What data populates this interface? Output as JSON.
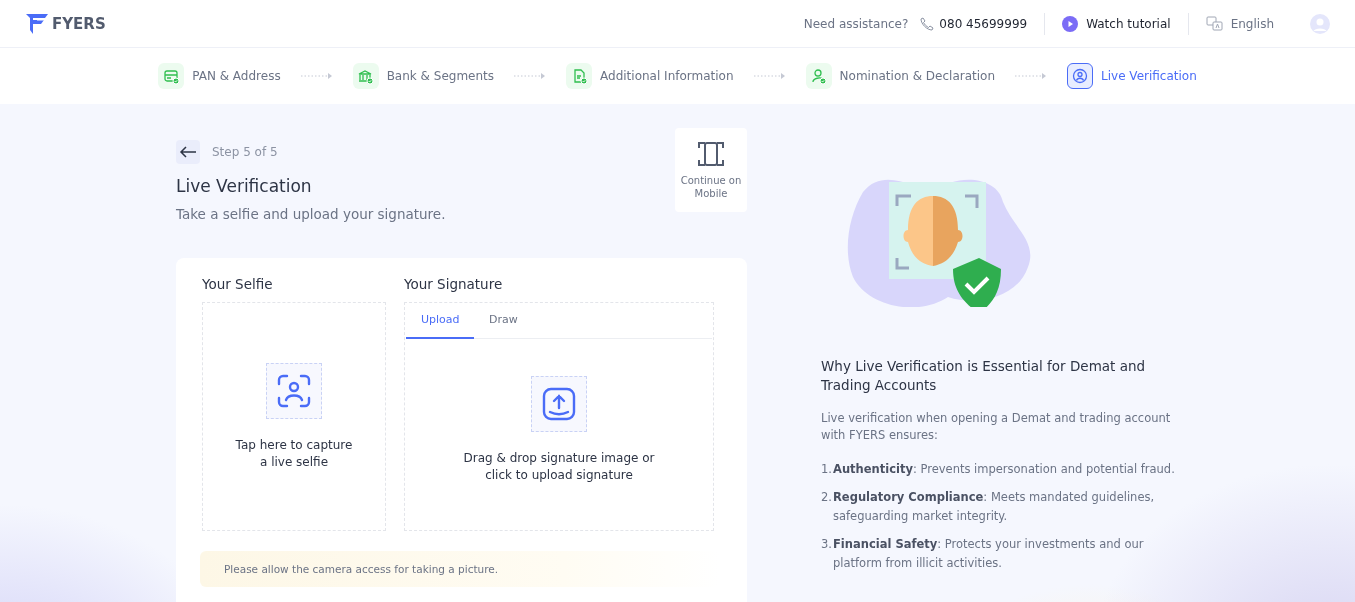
{
  "header": {
    "brand": "FYERS",
    "assistance_label": "Need assistance?",
    "phone": "080 45699999",
    "tutorial": "Watch tutorial",
    "language": "English"
  },
  "steps": [
    {
      "label": "PAN & Address",
      "completed": true,
      "selected": false
    },
    {
      "label": "Bank & Segments",
      "completed": true,
      "selected": false
    },
    {
      "label": "Additional Information",
      "completed": true,
      "selected": false
    },
    {
      "label": "Nomination & Declaration",
      "completed": true,
      "selected": false
    },
    {
      "label": "Live Verification",
      "completed": false,
      "selected": true
    }
  ],
  "page": {
    "step_text": "Step 5 of 5",
    "title": "Live Verification",
    "subtitle": "Take a selfie and upload your signature.",
    "mobile_button": "Continue on Mobile"
  },
  "selfie": {
    "title": "Your Selfie",
    "prompt": "Tap here to capture a live selfie"
  },
  "signature": {
    "title": "Your Signature",
    "tabs": [
      {
        "label": "Upload",
        "selected": true
      },
      {
        "label": "Draw",
        "selected": false
      }
    ],
    "prompt": "Drag & drop signature image or click to upload signature"
  },
  "notice": "Please allow the camera access for taking a picture.",
  "info": {
    "title": "Why Live Verification is Essential for Demat and Trading Accounts",
    "intro": "Live verification when opening a Demat and trading account with FYERS ensures:",
    "points": [
      {
        "number": "1.",
        "text": "**Authenticity**: Prevents impersonation and potential fraud."
      },
      {
        "number": "2.",
        "text": "**Regulatory Compliance**: Meets mandated guidelines, safeguarding market integrity."
      },
      {
        "number": "3.",
        "text": "**Financial Safety**: Protects your investments and our platform from illicit activities."
      }
    ]
  }
}
